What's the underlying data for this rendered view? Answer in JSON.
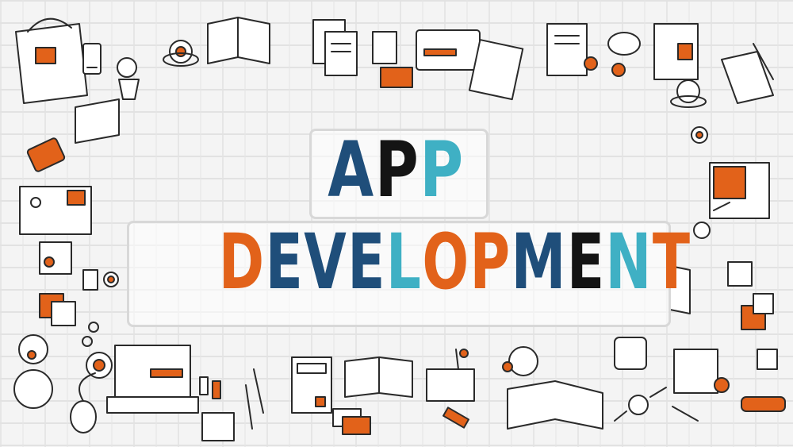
{
  "headline": {
    "line1": [
      "A",
      "P",
      "P"
    ],
    "line2": [
      "D",
      "E",
      "V",
      "E",
      "L",
      "O",
      "P",
      "M",
      "E",
      "N",
      "T"
    ]
  },
  "colors": {
    "navy": "#1f4e7a",
    "black": "#141414",
    "teal": "#3fb0c4",
    "orange": "#e2621a"
  }
}
